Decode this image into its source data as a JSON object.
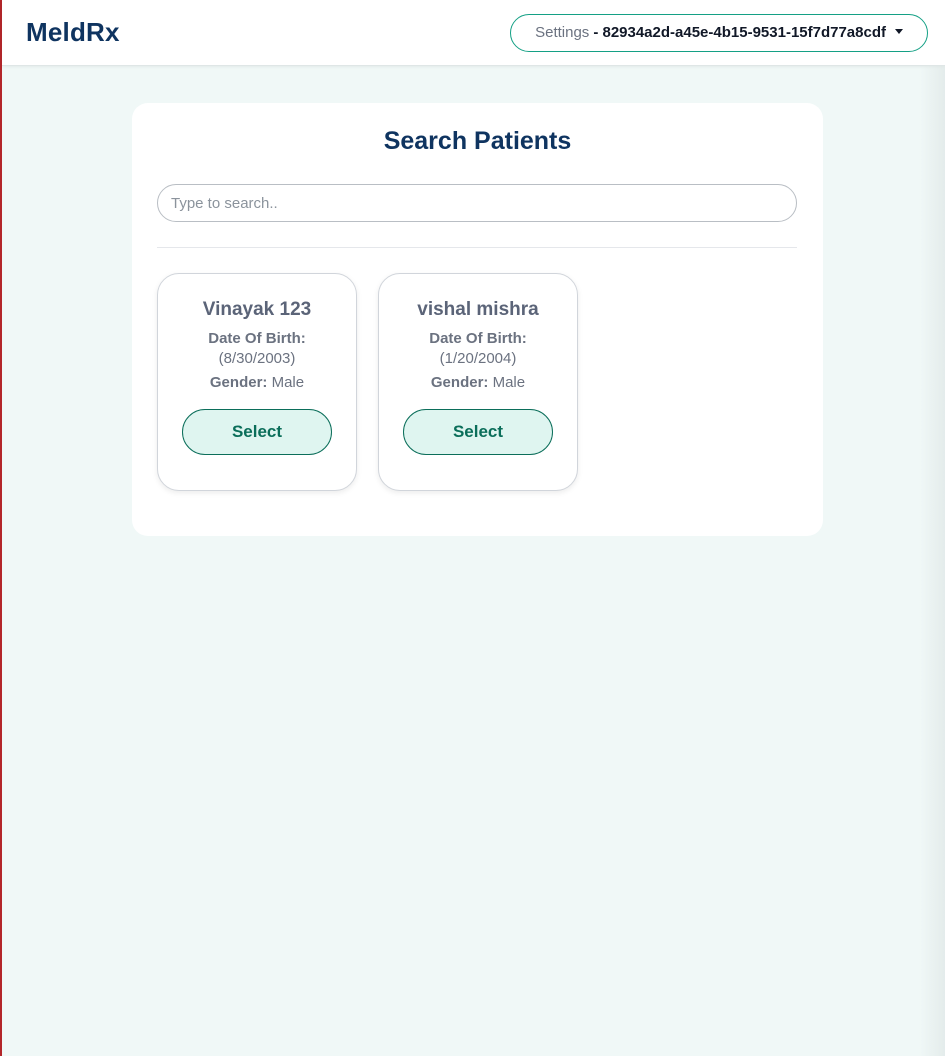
{
  "navbar": {
    "brand": "MeldRx",
    "settings_label": "Settings",
    "settings_id": "- 82934a2d-a45e-4b15-9531-15f7d77a8cdf"
  },
  "search": {
    "title": "Search Patients",
    "placeholder": "Type to search..",
    "value": ""
  },
  "patients": [
    {
      "name": "Vinayak 123",
      "dob_label": "Date Of Birth:",
      "dob_value": "(8/30/2003)",
      "gender_label": "Gender:",
      "gender_value": "Male",
      "button_label": "Select"
    },
    {
      "name": "vishal mishra",
      "dob_label": "Date Of Birth:",
      "dob_value": "(1/20/2004)",
      "gender_label": "Gender:",
      "gender_value": "Male",
      "button_label": "Select"
    }
  ],
  "colors": {
    "brand": "#0f3460",
    "accent": "#0b6e5a",
    "background": "#f0f8f7"
  }
}
